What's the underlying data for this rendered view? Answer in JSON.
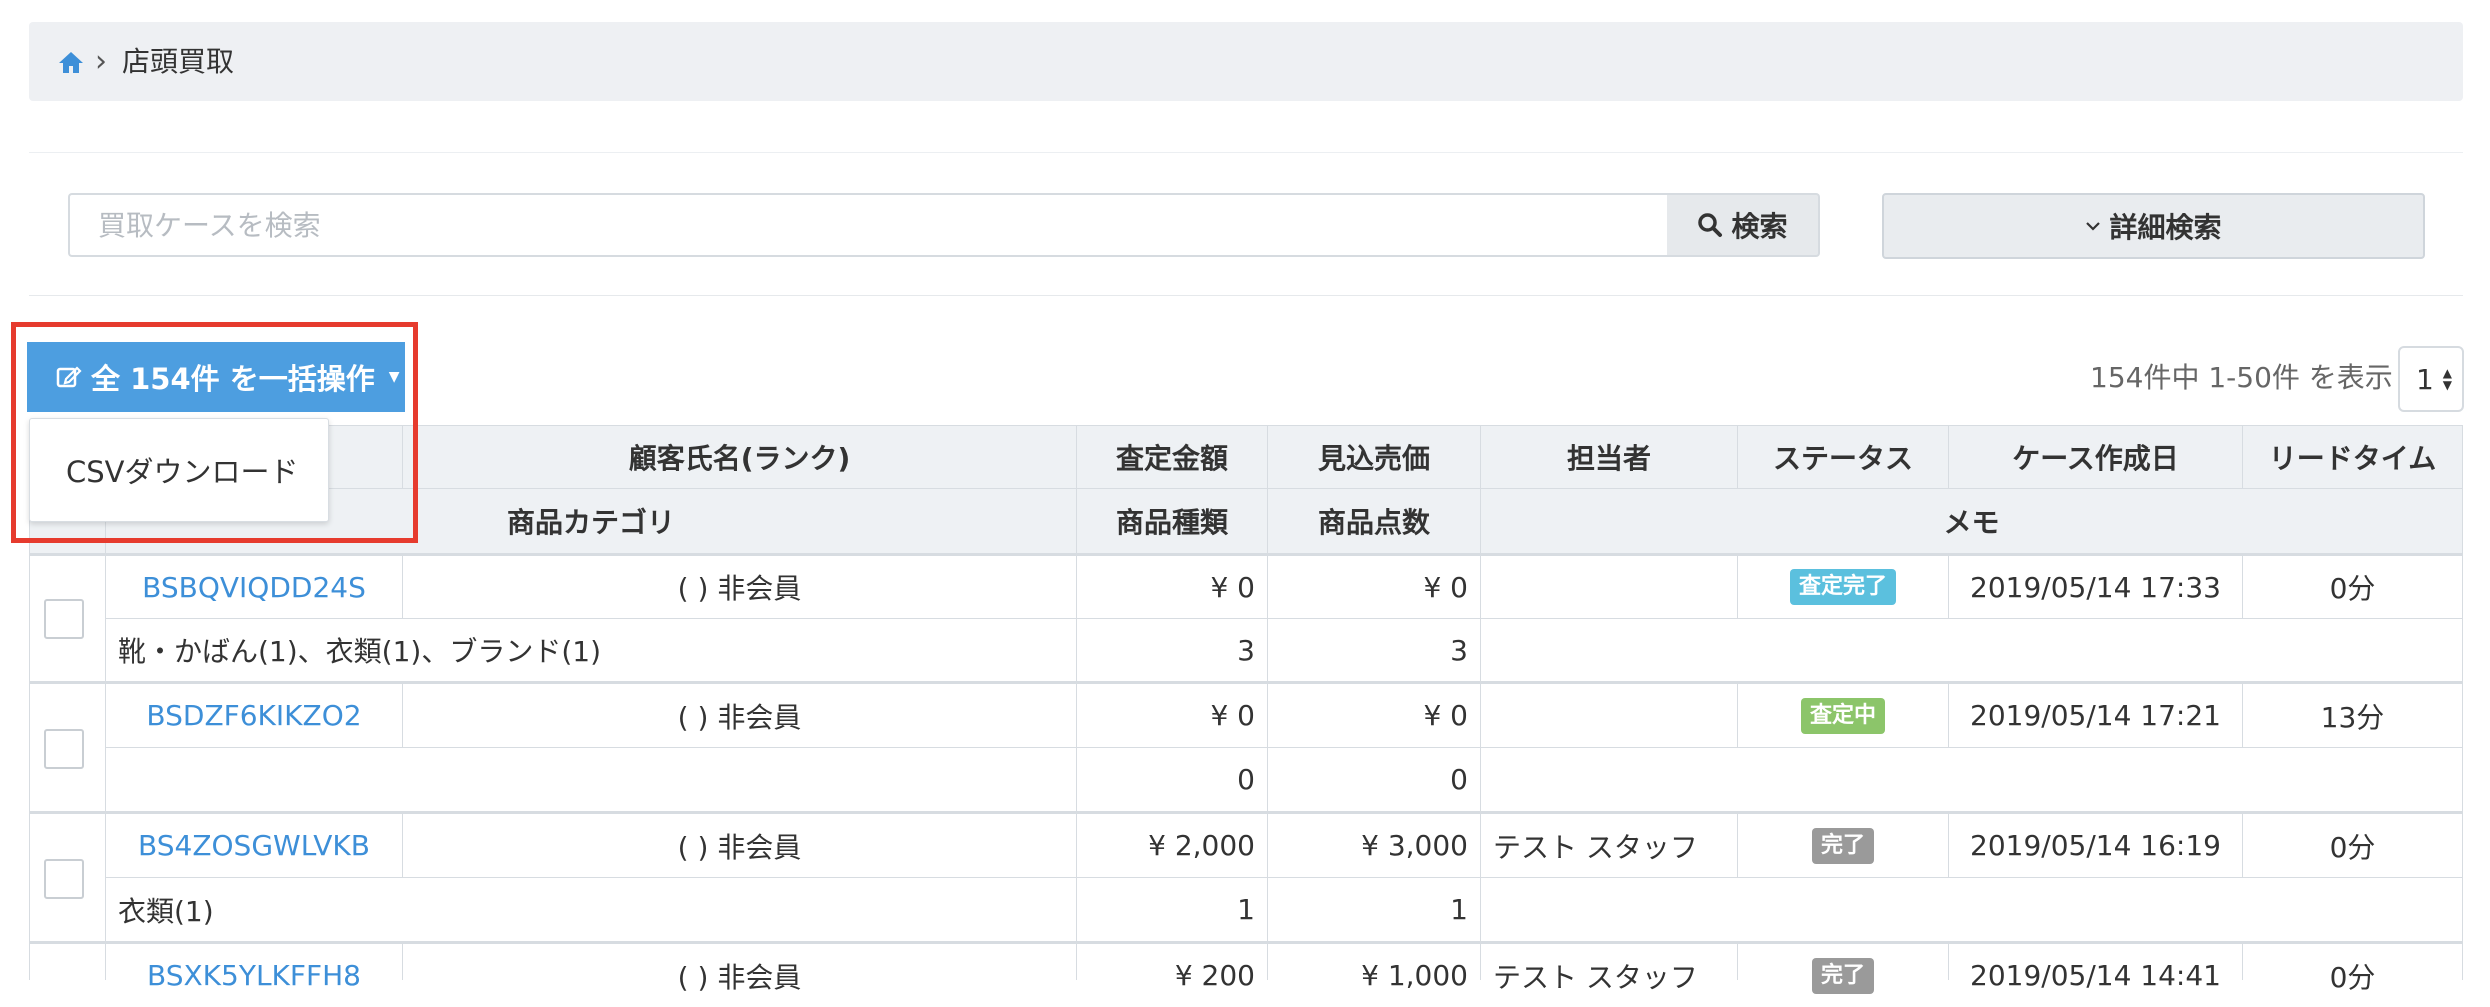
{
  "breadcrumb": {
    "current": "店頭買取",
    "separator": "›",
    "home_icon": "home-icon"
  },
  "search": {
    "placeholder": "買取ケースを検索",
    "button_label": "検索",
    "advanced_label": "詳細検索"
  },
  "bulk": {
    "button_label": "全 154件 を一括操作",
    "menu_items": [
      "CSVダウンロード"
    ]
  },
  "pagination": {
    "info": "154件中 1-50件 を表示",
    "page": "1"
  },
  "table": {
    "header_row1": [
      "顧客氏名(ランク)",
      "査定金額",
      "見込売価",
      "担当者",
      "ステータス",
      "ケース作成日",
      "リードタイム"
    ],
    "header_row2": [
      "商品カテゴリ",
      "商品種類",
      "商品点数",
      "メモ"
    ],
    "rows": [
      {
        "id": "BSBQVIQDD24S",
        "customer": "( ) 非会員",
        "appraisal": "¥ 0",
        "expected": "¥ 0",
        "staff": "",
        "status": "査定完了",
        "status_color": "#5bc0de",
        "created": "2019/05/14 17:33",
        "lead": "0分",
        "category": "靴・かばん(1)、衣類(1)、ブランド(1)",
        "kinds": "3",
        "count": "3",
        "memo": ""
      },
      {
        "id": "BSDZF6KIKZO2",
        "customer": "( ) 非会員",
        "appraisal": "¥ 0",
        "expected": "¥ 0",
        "staff": "",
        "status": "査定中",
        "status_color": "#8cc56a",
        "created": "2019/05/14 17:21",
        "lead": "13分",
        "category": "",
        "kinds": "0",
        "count": "0",
        "memo": ""
      },
      {
        "id": "BS4ZOSGWLVKB",
        "customer": "( ) 非会員",
        "appraisal": "¥ 2,000",
        "expected": "¥ 3,000",
        "staff": "テスト スタッフ",
        "status": "完了",
        "status_color": "#9a9a9a",
        "created": "2019/05/14 16:19",
        "lead": "0分",
        "category": "衣類(1)",
        "kinds": "1",
        "count": "1",
        "memo": ""
      },
      {
        "id": "BSXK5YLKFFH8",
        "customer": "( ) 非会員",
        "appraisal": "¥ 200",
        "expected": "¥ 1,000",
        "staff": "テスト スタッフ",
        "status": "完了",
        "status_color": "#9a9a9a",
        "created": "2019/05/14 14:41",
        "lead": "0分",
        "category": "",
        "kinds": "",
        "count": "",
        "memo": ""
      }
    ]
  }
}
